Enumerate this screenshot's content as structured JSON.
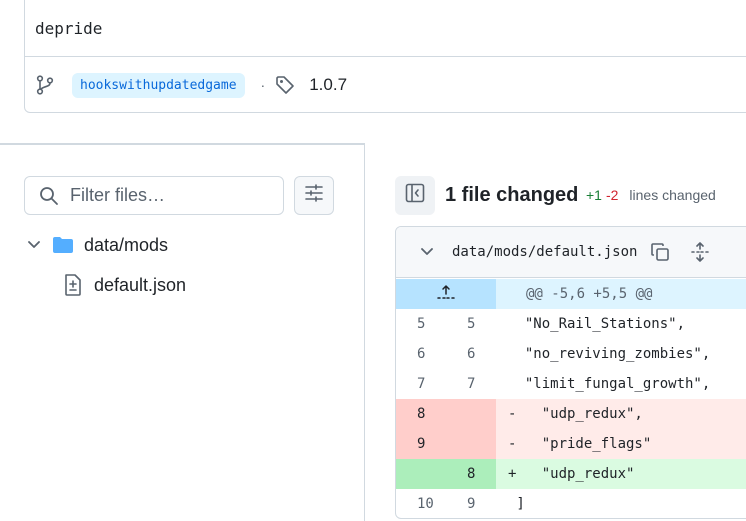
{
  "commit": {
    "message": "depride",
    "branch": "hookswithupdatedgame",
    "separator": "·",
    "tag": "1.0.7"
  },
  "sidebar": {
    "filter_placeholder": "Filter files…",
    "tree": {
      "folder": "data/mods",
      "file": "default.json"
    }
  },
  "diff_summary": {
    "title": "1 file changed",
    "additions": "+1",
    "deletions": "-2",
    "suffix": "lines changed"
  },
  "diff": {
    "path": "data/mods/default.json",
    "hunk": "@@ -5,6 +5,5 @@",
    "rows": [
      {
        "type": "context",
        "old": "5",
        "new": "5",
        "code": "  \"No_Rail_Stations\","
      },
      {
        "type": "context",
        "old": "6",
        "new": "6",
        "code": "  \"no_reviving_zombies\","
      },
      {
        "type": "context",
        "old": "7",
        "new": "7",
        "code": "  \"limit_fungal_growth\","
      },
      {
        "type": "del",
        "old": "8",
        "new": "",
        "code": "-   \"udp_redux\","
      },
      {
        "type": "del",
        "old": "9",
        "new": "",
        "code": "-   \"pride_flags\""
      },
      {
        "type": "add",
        "old": "",
        "new": "8",
        "code": "+   \"udp_redux\""
      },
      {
        "type": "context",
        "old": "10",
        "new": "9",
        "code": " ]"
      }
    ]
  },
  "colors": {
    "accent": "#0969da",
    "add_text": "#1a7f37",
    "del_text": "#d1242f",
    "hunk_bg": "#ddf4ff",
    "del_bg": "#ffebe9",
    "add_bg": "#dafbe1",
    "folder": "#54aeff"
  },
  "icons": {
    "branch": "git-branch-icon",
    "tag": "tag-icon",
    "search": "search-icon",
    "settings": "sliders-icon",
    "chevron": "chevron-down-icon",
    "folder": "folder-icon",
    "file": "file-diff-icon",
    "sidebar_toggle": "sidebar-collapse-icon",
    "copy": "copy-icon",
    "expand": "unfold-icon",
    "expand_up": "expand-up-icon"
  }
}
